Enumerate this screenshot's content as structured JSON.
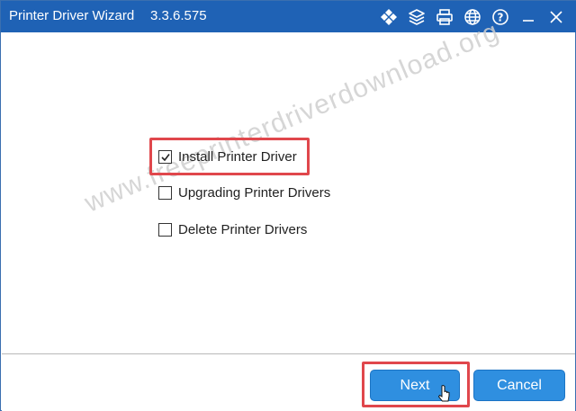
{
  "window": {
    "title": "Printer Driver Wizard",
    "version": "3.3.6.575"
  },
  "titlebar_icons": [
    "diamond-grid-icon",
    "layers-icon",
    "printer-icon",
    "globe-icon",
    "help-icon",
    "minimize-icon",
    "close-icon"
  ],
  "options": [
    {
      "label": "Install Printer Driver",
      "checked": true,
      "highlighted": true
    },
    {
      "label": "Upgrading Printer Drivers",
      "checked": false,
      "highlighted": false
    },
    {
      "label": "Delete Printer Drivers",
      "checked": false,
      "highlighted": false
    }
  ],
  "buttons": {
    "next": "Next",
    "cancel": "Cancel"
  },
  "watermark": "www.freeprinterdriverdownload.org",
  "colors": {
    "titlebar": "#1f62b5",
    "button": "#2f8fe0",
    "highlight": "#e0474c"
  }
}
